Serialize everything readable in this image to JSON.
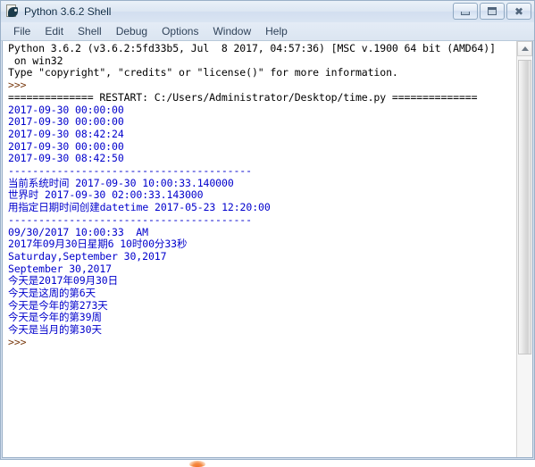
{
  "window": {
    "title": "Python 3.6.2 Shell",
    "icon": "python-idle-icon",
    "buttons": {
      "minimize": "minimize",
      "maximize": "maximize",
      "close": "close"
    }
  },
  "menubar": {
    "items": [
      {
        "label": "File"
      },
      {
        "label": "Edit"
      },
      {
        "label": "Shell"
      },
      {
        "label": "Debug"
      },
      {
        "label": "Options"
      },
      {
        "label": "Window"
      },
      {
        "label": "Help"
      }
    ]
  },
  "shell": {
    "lines": [
      {
        "text": "Python 3.6.2 (v3.6.2:5fd33b5, Jul  8 2017, 04:57:36) [MSC v.1900 64 bit (AMD64)]",
        "color": "black"
      },
      {
        "text": " on win32",
        "color": "black"
      },
      {
        "text": "Type \"copyright\", \"credits\" or \"license()\" for more information.",
        "color": "black"
      },
      {
        "text": ">>> ",
        "color": "prompt"
      },
      {
        "text": "============== RESTART: C:/Users/Administrator/Desktop/time.py ==============",
        "color": "black"
      },
      {
        "text": "2017-09-30 00:00:00",
        "color": "blue"
      },
      {
        "text": "2017-09-30 00:00:00",
        "color": "blue"
      },
      {
        "text": "2017-09-30 08:42:24",
        "color": "blue"
      },
      {
        "text": "2017-09-30 00:00:00",
        "color": "blue"
      },
      {
        "text": "2017-09-30 08:42:50",
        "color": "blue"
      },
      {
        "text": "----------------------------------------",
        "color": "blue"
      },
      {
        "text": "当前系统时间 2017-09-30 10:00:33.140000",
        "color": "blue"
      },
      {
        "text": "世界时 2017-09-30 02:00:33.143000",
        "color": "blue"
      },
      {
        "text": "用指定日期时间创建datetime 2017-05-23 12:20:00",
        "color": "blue"
      },
      {
        "text": "----------------------------------------",
        "color": "blue"
      },
      {
        "text": "09/30/2017 10:00:33  AM",
        "color": "blue"
      },
      {
        "text": "2017年09月30日星期6 10时00分33秒",
        "color": "blue"
      },
      {
        "text": "Saturday,September 30,2017",
        "color": "blue"
      },
      {
        "text": "September 30,2017",
        "color": "blue"
      },
      {
        "text": "今天是2017年09月30日",
        "color": "blue"
      },
      {
        "text": "今天是这周的第6天",
        "color": "blue"
      },
      {
        "text": "今天是今年的第273天",
        "color": "blue"
      },
      {
        "text": "今天是今年的第39周",
        "color": "blue"
      },
      {
        "text": "今天是当月的第30天",
        "color": "blue"
      },
      {
        "text": ">>> ",
        "color": "prompt"
      }
    ]
  },
  "scrollbar": {
    "up_arrow": "scroll-up-arrow"
  }
}
